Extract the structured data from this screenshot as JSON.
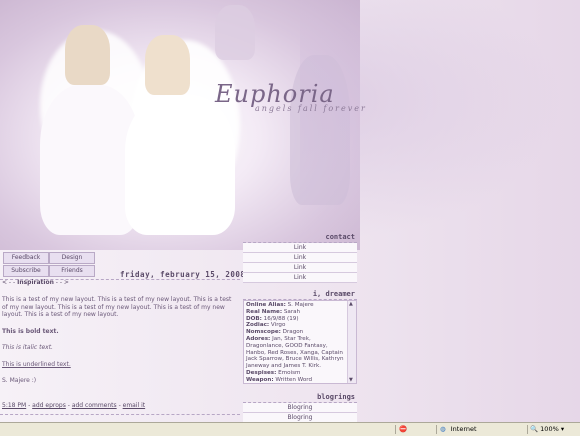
{
  "brand": {
    "name": "Euphoria",
    "tagline": "angels fall forever"
  },
  "nav": [
    "Feedback",
    "Design",
    "Subscribe",
    "Friends"
  ],
  "post": {
    "date": "friday, february 15, 2008",
    "inspiration_prefix": "< - - ",
    "inspiration_label": "Inspiration",
    "inspiration_suffix": " - - >",
    "paragraph": "This is a test of my new layout. This is a test of my new layout. This is a test of my new layout. This is a test of my new layout. This is a test of my new layout. This is a test of my new layout.",
    "bold": "This is bold text.",
    "italic": "This is italic text.",
    "underline": "This is underlined text.",
    "signature": "S. Majere :)"
  },
  "footer": {
    "time": "5:18 PM",
    "sep": " - ",
    "add_eprops": "add eprops",
    "add_comments": "add comments",
    "email_it": "email it"
  },
  "sidebar": {
    "contact_title": "contact",
    "contact_links": [
      "Link",
      "Link",
      "Link",
      "Link"
    ],
    "dreamer_title": "i, dreamer",
    "profile": [
      {
        "k": "Online Alias:",
        "v": " S. Majere"
      },
      {
        "k": "Real Name:",
        "v": " Sarah"
      },
      {
        "k": "DOB:",
        "v": " 16/9/88 (19)"
      },
      {
        "k": "Zodiac:",
        "v": " Virgo"
      },
      {
        "k": "Nomscope:",
        "v": " Dragon"
      },
      {
        "k": "Adores:",
        "v": " Jan, Star Trek, Dragonlance, GOOD Fantasy, Hanbo, Red Roses, Xanga, Captain Jack Sparrow, Bruce Willis, Kathryn Janeway and James T. Kirk."
      },
      {
        "k": "Despises:",
        "v": " Emoism"
      },
      {
        "k": "Weapon:",
        "v": " Written Word"
      }
    ],
    "blogrings_title": "blogrings",
    "blogrings": [
      "Blogring",
      "Blogring"
    ]
  },
  "statusbar": {
    "zone": "Internet",
    "zoom": "100%"
  }
}
